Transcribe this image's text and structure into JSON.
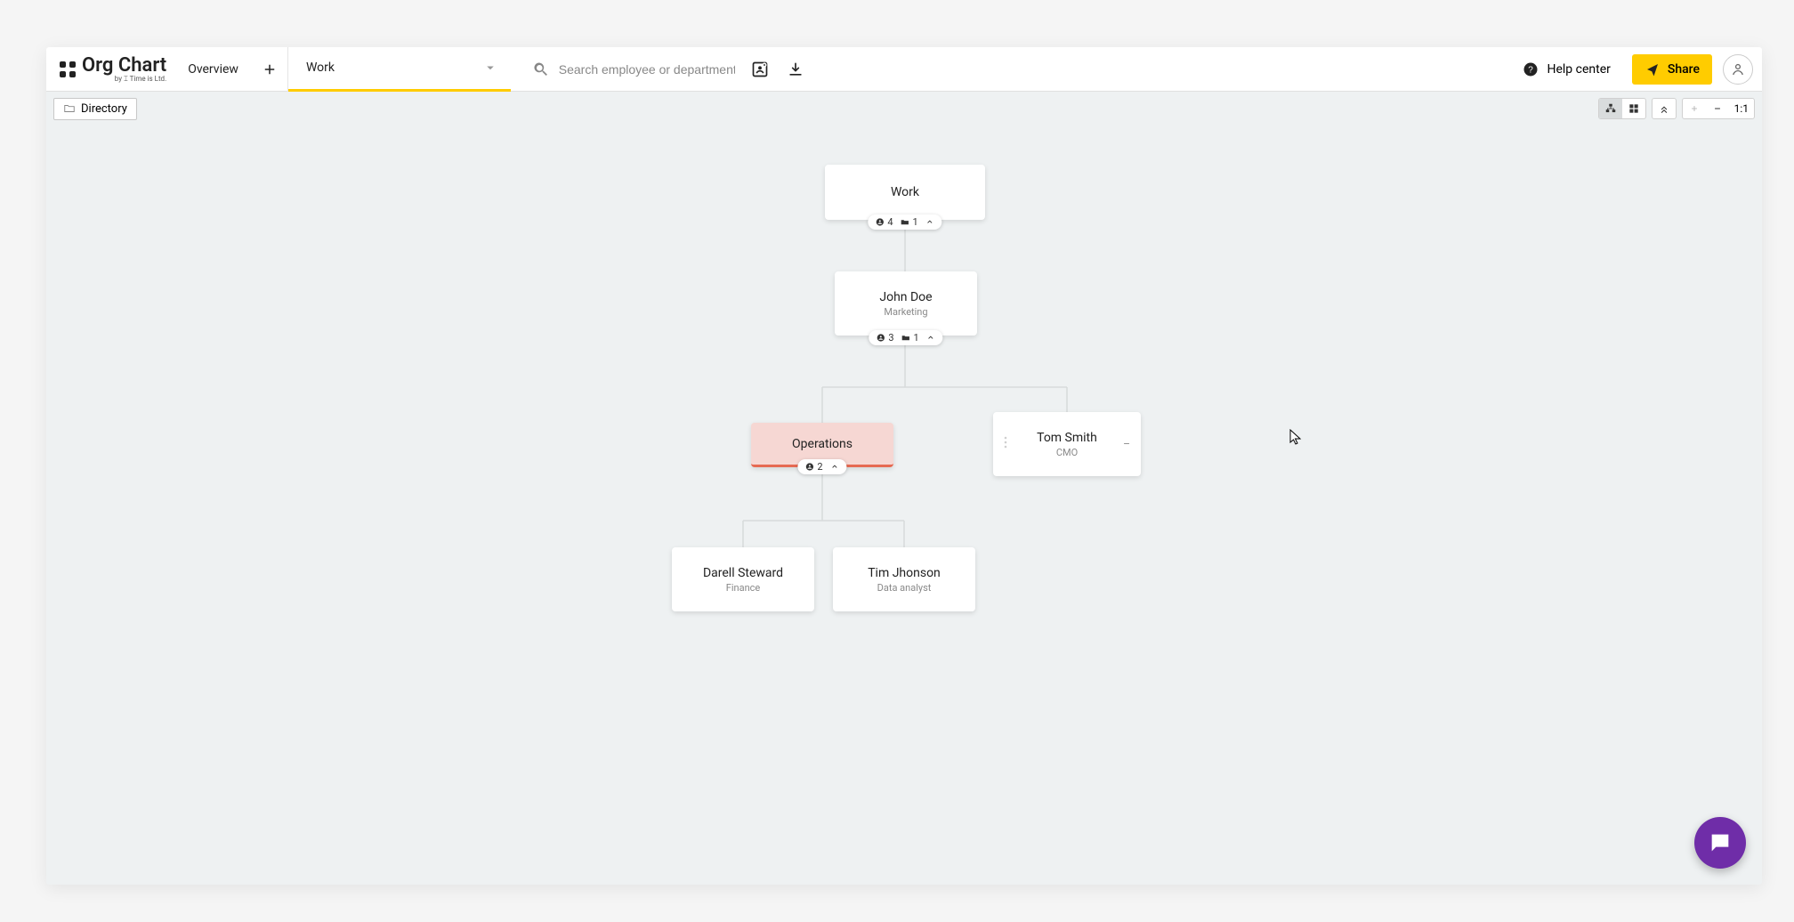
{
  "brand": {
    "name": "Org Chart",
    "tagline": "by ⌶ Time is Ltd."
  },
  "topbar": {
    "overview_label": "Overview",
    "dropdown_value": "Work",
    "search_placeholder": "Search employee or department",
    "help_label": "Help center",
    "share_label": "Share"
  },
  "subbar": {
    "directory_label": "Directory",
    "zoom_label": "1:1"
  },
  "nodes": {
    "work": {
      "title": "Work",
      "people": "4",
      "depts": "1"
    },
    "john": {
      "title": "John Doe",
      "subtitle": "Marketing",
      "people": "3",
      "depts": "1"
    },
    "ops": {
      "title": "Operations",
      "people": "2"
    },
    "tom": {
      "title": "Tom Smith",
      "subtitle": "CMO"
    },
    "darell": {
      "title": "Darell Steward",
      "subtitle": "Finance"
    },
    "tim": {
      "title": "Tim Jhonson",
      "subtitle": "Data analyst"
    }
  }
}
